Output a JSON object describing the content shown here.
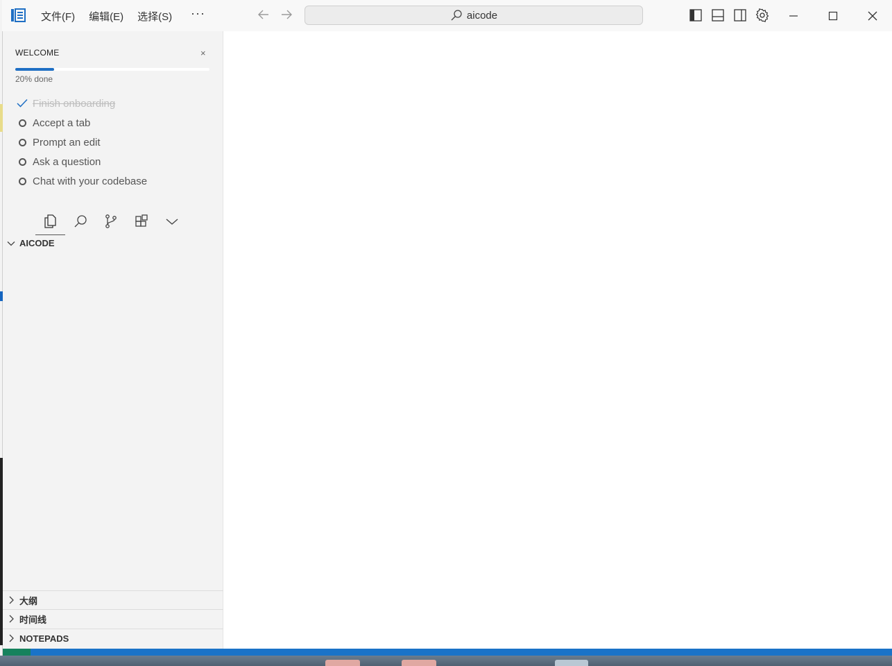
{
  "menu": {
    "file": "文件(F)",
    "edit": "编辑(E)",
    "select": "选择(S)",
    "more": "···"
  },
  "search": {
    "text": "aicode"
  },
  "welcome": {
    "title": "WELCOME",
    "close": "×",
    "progress_text": "20% done",
    "progress_value": 0.2,
    "items": [
      {
        "label": "Finish onboarding",
        "done": true
      },
      {
        "label": "Accept a tab",
        "done": false
      },
      {
        "label": "Prompt an edit",
        "done": false
      },
      {
        "label": "Ask a question",
        "done": false
      },
      {
        "label": "Chat with your codebase",
        "done": false
      }
    ]
  },
  "explorer": {
    "title": "AICODE"
  },
  "sections": {
    "outline": "大纲",
    "timeline": "时间线",
    "notepads": "NOTEPADS"
  },
  "colors": {
    "accent": "#1f6fc4",
    "statusbar": "#1a73c8",
    "remote": "#16825d"
  }
}
